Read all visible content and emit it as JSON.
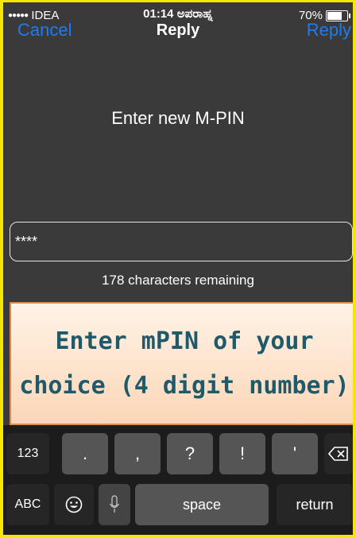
{
  "status_bar": {
    "carrier_dots": "●●●●●",
    "carrier": "IDEA",
    "time": "01:14 ಅಪರಾಹ್ನ",
    "battery": "70%"
  },
  "nav": {
    "cancel": "Cancel",
    "title": "Reply",
    "reply": "Reply"
  },
  "prompt": "Enter new M-PIN",
  "input": {
    "value": "****"
  },
  "remaining": "178 characters remaining",
  "banner": {
    "line1": "Enter mPIN of your",
    "line2": "choice (4 digit number)"
  },
  "keyboard": {
    "row1": [
      "123",
      ".",
      ",",
      "?",
      "!",
      "'"
    ],
    "row2": {
      "abc": "ABC",
      "space": "space",
      "return": "return"
    },
    "icons": [
      "backspace-icon",
      "emoji-icon",
      "microphone-icon"
    ]
  },
  "colors": {
    "accent": "#1e7cf2",
    "banner_text": "#1f5a6b",
    "border": "#f5e600"
  }
}
